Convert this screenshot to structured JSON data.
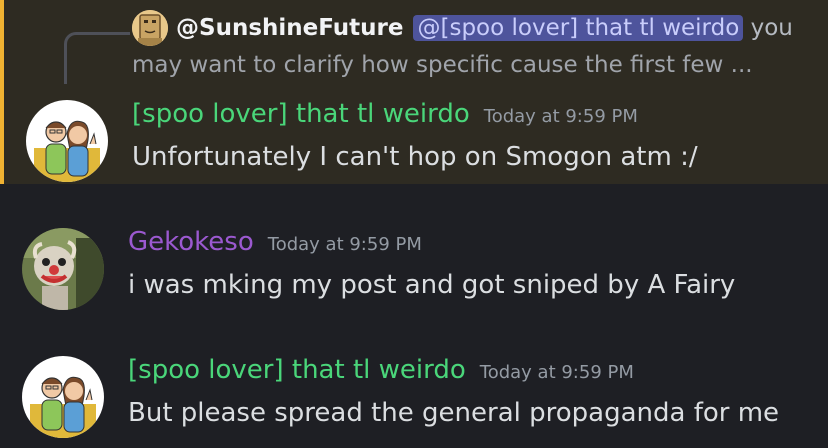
{
  "messages": [
    {
      "reply": {
        "author": "@SunshineFuture",
        "mention": "@[spoo lover] that tl weirdo",
        "text_line1": " you",
        "text_line2": "may want to clarify how specific cause the first few ..."
      },
      "username": "[spoo lover] that tl weirdo",
      "timestamp": "Today at 9:59 PM",
      "content": "Unfortunately I can't hop on Smogon atm :/",
      "highlighted": true,
      "username_color": "#4ad67a"
    },
    {
      "username": "Gekokeso",
      "timestamp": "Today at 9:59 PM",
      "content": "i was mking my post and got sniped by A Fairy",
      "highlighted": false,
      "username_color": "#9b59d0"
    },
    {
      "username": "[spoo lover] that tl weirdo",
      "timestamp": "Today at 9:59 PM",
      "content": "But please spread the general propaganda for me",
      "highlighted": false,
      "username_color": "#4ad67a"
    }
  ],
  "colors": {
    "background": "#1e1f24",
    "highlight_background": "#2e2b22",
    "highlight_border": "#f0b232",
    "mention_background": "#4e549c",
    "mention_text": "#c9cdfb"
  }
}
